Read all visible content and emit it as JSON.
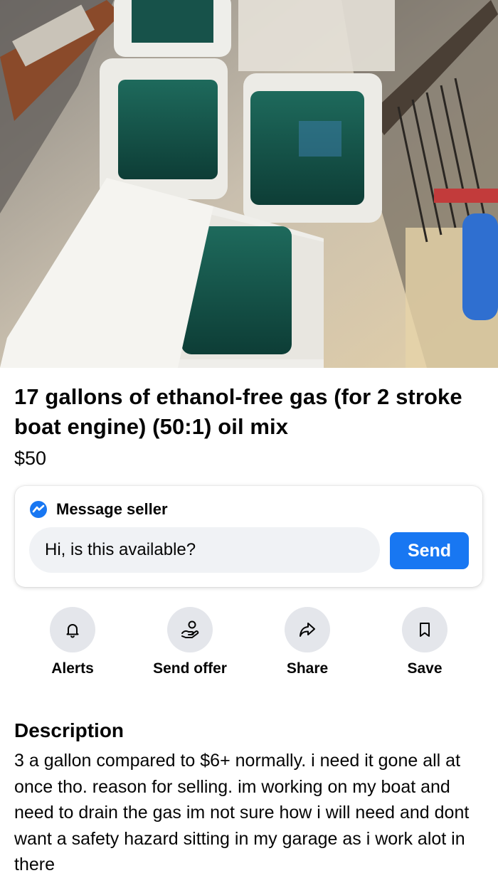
{
  "listing": {
    "title": "17 gallons of ethanol-free gas (for 2 stroke boat engine) (50:1) oil mix",
    "price": "$50"
  },
  "message": {
    "header": "Message seller",
    "input_value": "Hi, is this available?",
    "send_label": "Send",
    "accent_color": "#1877f2"
  },
  "actions": [
    {
      "label": "Alerts",
      "icon": "bell-icon"
    },
    {
      "label": "Send offer",
      "icon": "offer-icon"
    },
    {
      "label": "Share",
      "icon": "share-icon"
    },
    {
      "label": "Save",
      "icon": "bookmark-icon"
    }
  ],
  "description": {
    "heading": "Description",
    "text": "3 a gallon compared to $6+ normally. i need it gone all at once tho. reason for selling. im working on my boat and need to drain the gas im not sure how i will need and dont want a safety hazard sitting in my garage as i work alot in there"
  }
}
